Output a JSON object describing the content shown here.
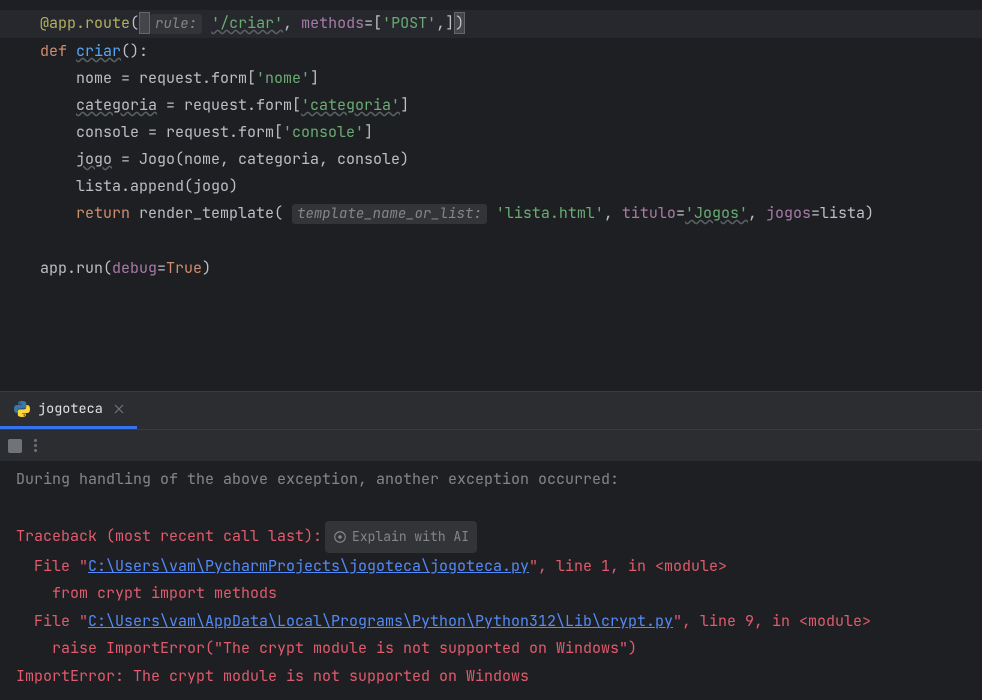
{
  "editor": {
    "lines": {
      "l1": {
        "decorator": "@app.route",
        "hint": "rule:",
        "rule": "'/criar'",
        "methods_key": "methods",
        "post": "'POST'"
      },
      "l2": {
        "def": "def",
        "name": "criar",
        "sig": "():"
      },
      "l3": {
        "var": "nome = request.form[",
        "key": "'nome'",
        "end": "]"
      },
      "l4": {
        "var": "categoria",
        "mid": " = request.form[",
        "key": "'categoria'",
        "end": "]"
      },
      "l5": {
        "var": "console = request.form[",
        "key": "'console'",
        "end": "]"
      },
      "l6": {
        "var": "jogo",
        "rest": " = Jogo(nome, categoria, console)"
      },
      "l7": {
        "text": "lista.append(jogo)"
      },
      "l8": {
        "ret": "return",
        "fn": " render_template(",
        "hint": "template_name_or_list:",
        "tmpl": "'lista.html'",
        "titulo_k": "titulo",
        "titulo_v": "'Jogos'",
        "jogos_k": "jogos",
        "lista": "=lista)"
      },
      "l9": {
        "text": "app.run(",
        "debug": "debug",
        "eq": "=",
        "true": "True",
        "end": ")"
      }
    }
  },
  "tab": {
    "label": "jogoteca"
  },
  "console": {
    "line1": "During handling of the above exception, another exception occurred:",
    "line3": "Traceback (most recent call last):",
    "ai_label": "Explain with AI",
    "file1_pre": "  File \"",
    "file1_path": "C:\\Users\\vam\\PycharmProjects\\jogoteca\\jogoteca.py",
    "file1_post": "\", line 1, in <module>",
    "import_line": "    from crypt import methods",
    "file2_pre": "  File \"",
    "file2_path": "C:\\Users\\vam\\AppData\\Local\\Programs\\Python\\Python312\\Lib\\crypt.py",
    "file2_post": "\", line 9, in <module>",
    "raise_line": "    raise ImportError(\"The crypt module is not supported on Windows\")",
    "final_err": "ImportError: The crypt module is not supported on Windows"
  }
}
